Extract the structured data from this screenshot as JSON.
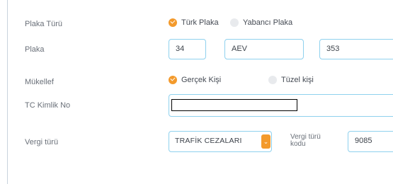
{
  "plaka_turu": {
    "label": "Plaka Türü",
    "options": [
      {
        "label": "Türk Plaka",
        "checked": true
      },
      {
        "label": "Yabancı Plaka",
        "checked": false
      }
    ]
  },
  "plaka": {
    "label": "Plaka",
    "il_kodu": "34",
    "harf": "AEV",
    "numara": "353"
  },
  "mukellef": {
    "label": "Mükellef",
    "options": [
      {
        "label": "Gerçek Kişi",
        "checked": true
      },
      {
        "label": "Tüzel kişi",
        "checked": false
      }
    ]
  },
  "tc_kimlik": {
    "label": "TC Kimlik No",
    "value": ""
  },
  "vergi": {
    "label": "Vergi türü",
    "selected": "TRAFİK CEZALARI",
    "kod_label_line1": "Vergi türü",
    "kod_label_line2": "kodu",
    "kod": "9085"
  },
  "colors": {
    "accent": "#f39a2c",
    "input_border": "#8fd1ee"
  }
}
